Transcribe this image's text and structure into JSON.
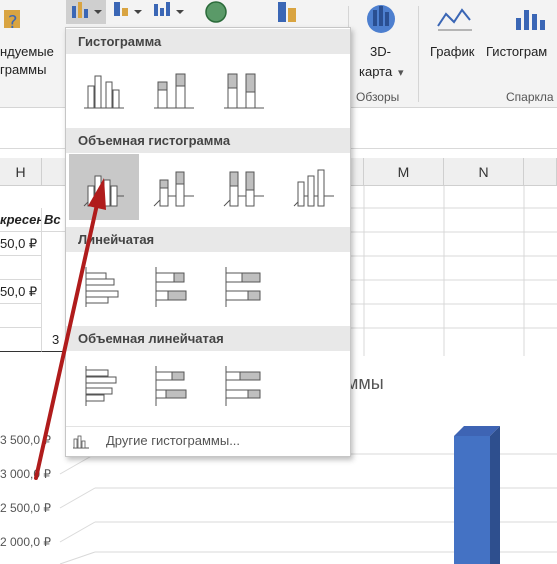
{
  "ribbon": {
    "left_label_1": "ндуемые",
    "left_label_2": "граммы",
    "map3d_1": "3D-",
    "map3d_2": "карта",
    "map3d_arrow": "▾",
    "tours_group": "Обзоры",
    "line_chart": "График",
    "histogram": "Гистограм",
    "sparklines_group": "Спаркла"
  },
  "columns": [
    "H",
    "M",
    "N"
  ],
  "cells": {
    "header_1": "кресен",
    "header_2": "Вс",
    "r1": "50,0 ₽",
    "r3": "50,0 ₽",
    "r5": "3"
  },
  "chart": {
    "title_fragment": "ммы",
    "y_labels": [
      "3 500,0 ₽",
      "3 000,0 ₽",
      "2 500,0 ₽",
      "2 000,0 ₽"
    ]
  },
  "dropdown": {
    "sections": [
      {
        "title": "Гистограмма",
        "options": [
          "clustered-column",
          "stacked-column",
          "100-stacked-column"
        ]
      },
      {
        "title": "Объемная гистограмма",
        "options": [
          "3d-clustered-column",
          "3d-stacked-column",
          "3d-100-stacked-column",
          "3d-column"
        ]
      },
      {
        "title": "Линейчатая",
        "options": [
          "clustered-bar",
          "stacked-bar",
          "100-stacked-bar"
        ]
      },
      {
        "title": "Объемная линейчатая",
        "options": [
          "3d-clustered-bar",
          "3d-stacked-bar",
          "3d-100-stacked-bar"
        ]
      }
    ],
    "selected": "3d-clustered-column",
    "more_label": "Другие гистограммы..."
  },
  "colors": {
    "accent_bar": "#4472c4",
    "arrow": "#b01c1c",
    "selected_bg": "#c8c8c8"
  }
}
